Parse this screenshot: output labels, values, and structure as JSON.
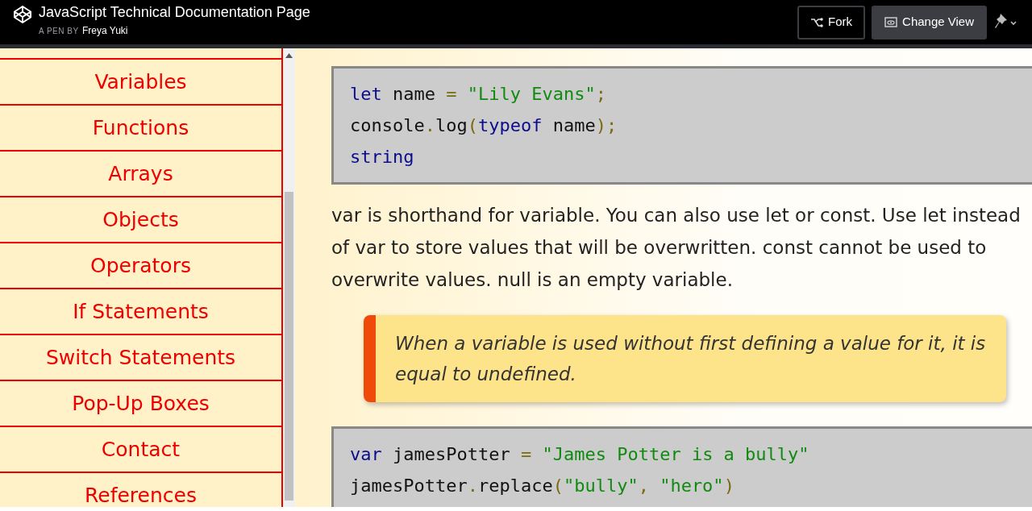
{
  "header": {
    "title": "JavaScript Technical Documentation Page",
    "byline": "A PEN BY",
    "author": "Freya Yuki",
    "buttons": [
      {
        "label": "Fork",
        "kind": "fork"
      },
      {
        "label": "Change View",
        "kind": "view"
      }
    ]
  },
  "sidebar": {
    "items": [
      {
        "label": "Variables"
      },
      {
        "label": "Functions"
      },
      {
        "label": "Arrays"
      },
      {
        "label": "Objects"
      },
      {
        "label": "Operators"
      },
      {
        "label": "If Statements"
      },
      {
        "label": "Switch Statements"
      },
      {
        "label": "Pop-Up Boxes"
      },
      {
        "label": "Contact"
      },
      {
        "label": "References"
      }
    ]
  },
  "content": [
    {
      "kind": "code",
      "lines": [
        [
          {
            "kind": "keyword",
            "text": "let"
          },
          {
            "kind": "plain",
            "text": " name"
          },
          {
            "kind": "punct",
            "text": " = "
          },
          {
            "kind": "string",
            "text": "\"Lily Evans\""
          },
          {
            "kind": "punct",
            "text": ";"
          }
        ],
        [
          {
            "kind": "plain",
            "text": "console"
          },
          {
            "kind": "punct",
            "text": "."
          },
          {
            "kind": "plain",
            "text": "log"
          },
          {
            "kind": "punct",
            "text": "("
          },
          {
            "kind": "keyword",
            "text": "typeof"
          },
          {
            "kind": "plain",
            "text": " name"
          },
          {
            "kind": "punct",
            "text": ");"
          }
        ],
        [
          {
            "kind": "keyword",
            "text": "string"
          }
        ]
      ]
    },
    {
      "kind": "paragraph",
      "text": "var is shorthand for variable. You can also use let or const. Use let instead of var to store values that will be overwritten. const cannot be used to overwrite values. null is an empty variable."
    },
    {
      "kind": "note",
      "text": "When a variable is used without first defining a value for it, it is equal to undefined."
    },
    {
      "kind": "code",
      "lines": [
        [
          {
            "kind": "keyword",
            "text": "var"
          },
          {
            "kind": "plain",
            "text": " jamesPotter"
          },
          {
            "kind": "punct",
            "text": " = "
          },
          {
            "kind": "string",
            "text": "\"James Potter is a bully\""
          }
        ],
        [
          {
            "kind": "plain",
            "text": "jamesPotter"
          },
          {
            "kind": "punct",
            "text": "."
          },
          {
            "kind": "plain",
            "text": "replace"
          },
          {
            "kind": "punct",
            "text": "("
          },
          {
            "kind": "string",
            "text": "\"bully\""
          },
          {
            "kind": "punct",
            "text": ", "
          },
          {
            "kind": "string",
            "text": "\"hero\""
          },
          {
            "kind": "punct",
            "text": ")"
          }
        ]
      ]
    }
  ]
}
